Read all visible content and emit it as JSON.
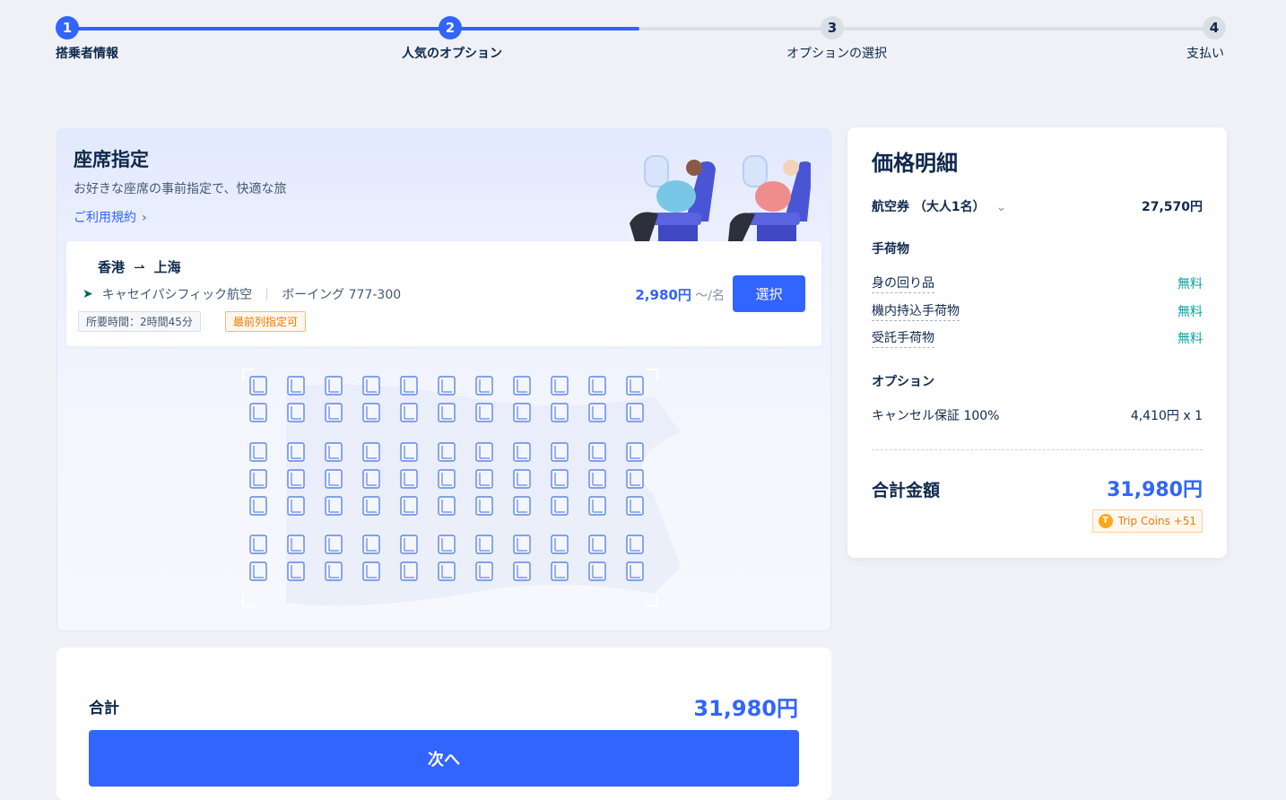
{
  "stepper": {
    "steps": [
      {
        "number": "1",
        "label": "搭乗者情報",
        "state": "completed"
      },
      {
        "number": "2",
        "label": "人気のオプション",
        "state": "current"
      },
      {
        "number": "3",
        "label": "オプションの選択",
        "state": "pending"
      },
      {
        "number": "4",
        "label": "支払い",
        "state": "pending"
      }
    ],
    "progress_fraction": 0.5
  },
  "seat_selection": {
    "title": "座席指定",
    "subtitle": "お好きな座席の事前指定で、快適な旅",
    "terms_link": "ご利用規約",
    "flight": {
      "origin": "香港",
      "destination": "上海",
      "arrow": "⇀",
      "airline": "キャセイパシフィック航空",
      "aircraft": "ボーイング 777-300",
      "duration_tag": "所要時間：2時間45分",
      "front_row_tag": "最前列指定可",
      "price": "2,980円",
      "price_unit": "～/名",
      "select_label": "選択"
    }
  },
  "price_details": {
    "title": "価格明細",
    "ticket_label": "航空券 （大人1名）",
    "ticket_price": "27,570円",
    "baggage_section": "手荷物",
    "baggage_items": [
      {
        "label": "身の回り品",
        "value": "無料"
      },
      {
        "label": "機内持込手荷物",
        "value": "無料"
      },
      {
        "label": "受託手荷物",
        "value": "無料"
      }
    ],
    "options_section": "オプション",
    "option_item": {
      "label": "キャンセル保証 100%",
      "value": "4,410円 x 1"
    },
    "total_label": "合計金額",
    "total_value": "31,980円",
    "coins_label": "Trip Coins +51",
    "coin_glyph": "T"
  },
  "footer": {
    "total_label": "合計",
    "total_value": "31,980円",
    "next_label": "次へ"
  },
  "colors": {
    "primary": "#3264ff",
    "text": "#0f294d",
    "free": "#0aa3a3",
    "warning": "#f07a00"
  }
}
